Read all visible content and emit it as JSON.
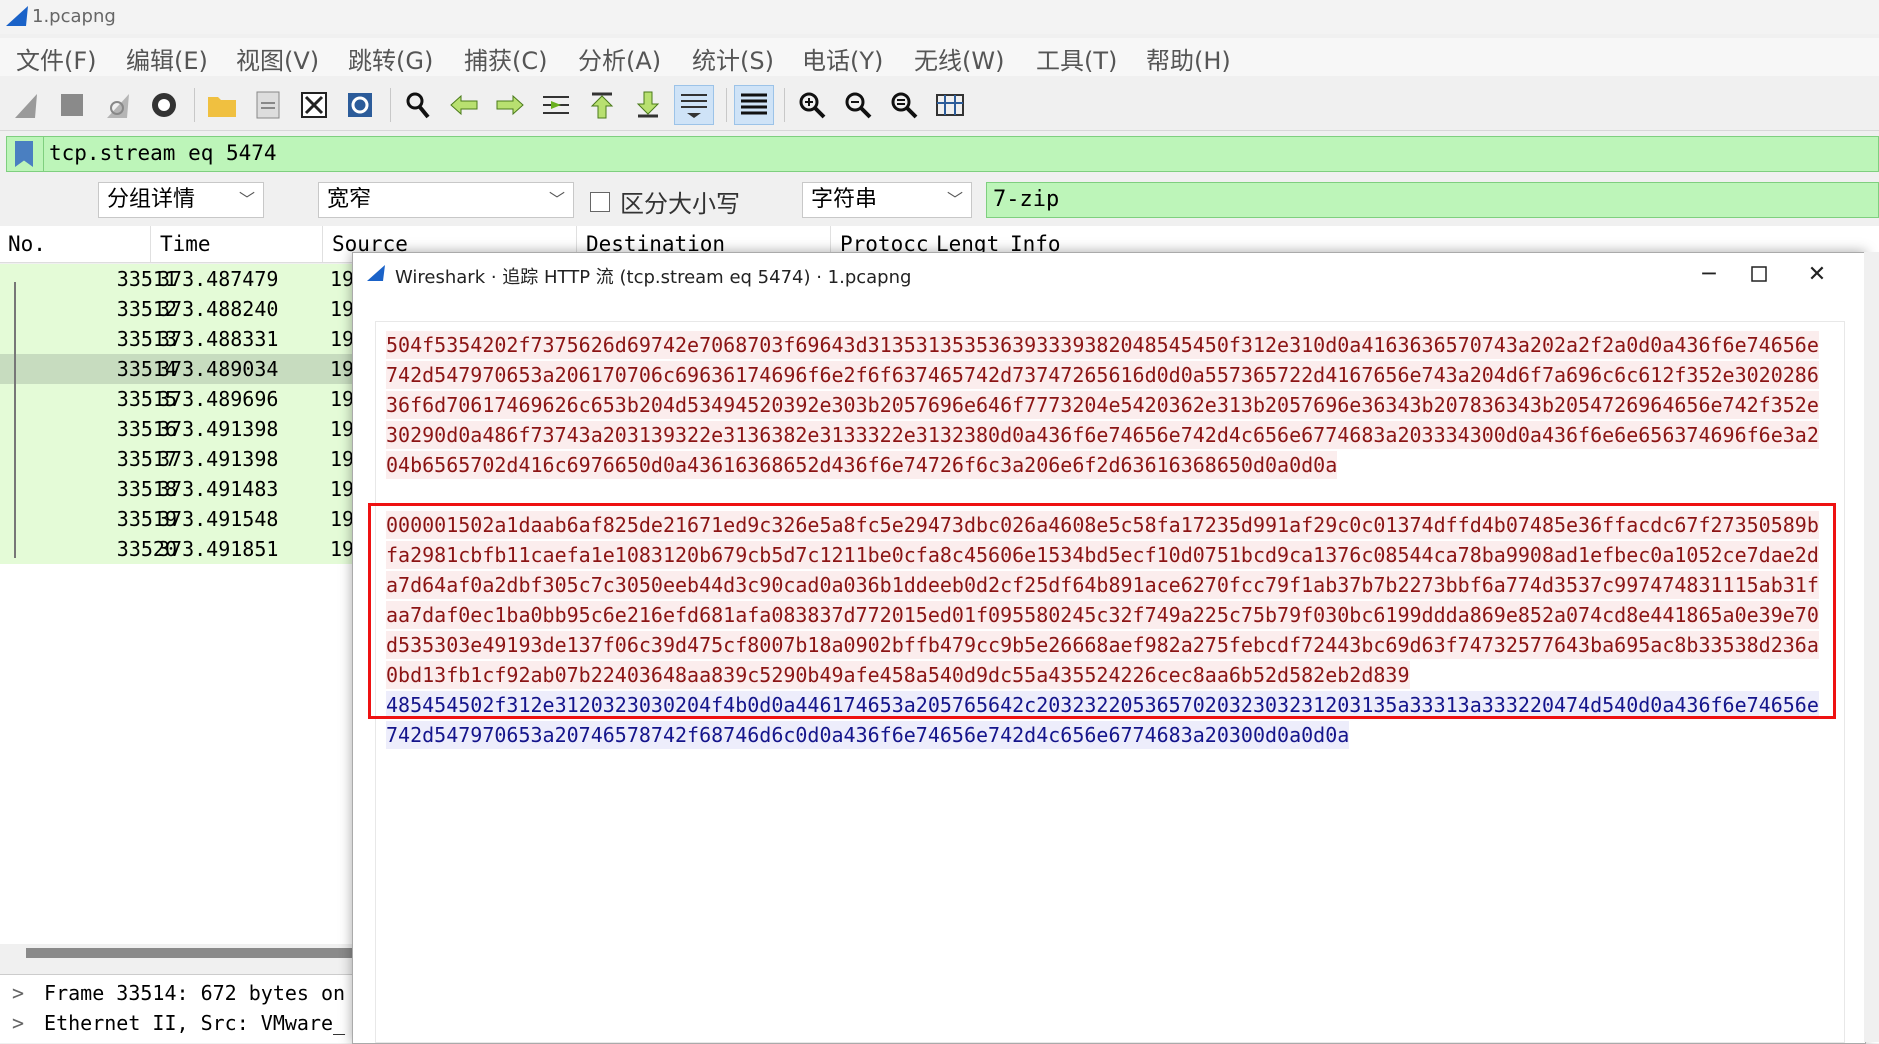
{
  "window": {
    "title": "1.pcapng"
  },
  "menu": [
    "文件(F)",
    "编辑(E)",
    "视图(V)",
    "跳转(G)",
    "捕获(C)",
    "分析(A)",
    "统计(S)",
    "电话(Y)",
    "无线(W)",
    "工具(T)",
    "帮助(H)"
  ],
  "filter": {
    "value": "tcp.stream eq 5474"
  },
  "search": {
    "scope": "分组详情",
    "width_mode": "宽窄",
    "case_sensitive_label": "区分大小写",
    "type": "字符串",
    "value": "7-zip"
  },
  "packet_list": {
    "columns": [
      "No.",
      "Time",
      "Source",
      "Destination",
      "Protocc",
      "Lengt",
      "Info"
    ],
    "rows": [
      {
        "no": "33511",
        "time": "373.487479",
        "src": "19"
      },
      {
        "no": "33512",
        "time": "373.488240",
        "src": "19"
      },
      {
        "no": "33513",
        "time": "373.488331",
        "src": "19"
      },
      {
        "no": "33514",
        "time": "373.489034",
        "src": "19"
      },
      {
        "no": "33515",
        "time": "373.489696",
        "src": "19"
      },
      {
        "no": "33516",
        "time": "373.491398",
        "src": "19"
      },
      {
        "no": "33517",
        "time": "373.491398",
        "src": "19"
      },
      {
        "no": "33518",
        "time": "373.491483",
        "src": "19"
      },
      {
        "no": "33519",
        "time": "373.491548",
        "src": "19"
      },
      {
        "no": "33520",
        "time": "373.491851",
        "src": "19"
      }
    ]
  },
  "details": [
    "Frame 33514: 672 bytes on",
    "Ethernet II, Src: VMware_"
  ],
  "dialog": {
    "title": "Wireshark · 追踪 HTTP 流 (tcp.stream eq 5474) · 1.pcapng",
    "client_request": "504f5354202f7375626d69742e7068703f69643d313531353536393339382048545450f312e310d0a4163636570743a202a2f2a0d0a436f6e74656e742d547970653a206170706c69636174696f6e2f6f637465742d73747265616d0d0a557365722d4167656e743a204d6f7a696c6c612f352e302028636f6d70617469626c653b204d53494520392e303b2057696e646f7773204e5420362e313b2057696e36343b207836343b2054726964656e742f352e30290d0a486f73743a203139322e3136382e3133322e3132380d0a436f6e74656e742d4c656e6774683a203334300d0a436f6e6e656374696f6e3a204b6565702d416c6976650d0a43616368652d436f6e74726f6c3a206e6f2d63616368650d0a0d0a",
    "client_body": "000001502a1daab6af825de21671ed9c326e5a8fc5e29473dbc026a4608e5c58fa17235d991af29c0c01374dffd4b07485e36ffacdc67f27350589bfa2981cbfb11caefa1e1083120b679cb5d7c1211be0cfa8c45606e1534bd5ecf10d0751bcd9ca1376c08544ca78ba9908ad1efbec0a1052ce7dae2da7d64af0a2dbf305c7c3050eeb44d3c90cad0a036b1ddeeb0d2cf25df64b891ace6270fcc79f1ab37b7b2273bbf6a774d3537c997474831115ab31faa7daf0ec1ba0bb95c6e216efd681afa083837d772015ed01f095580245c32f749a225c75b79f030bc6199ddda869e852a074cd8e441865a0e39e70d535303e49193de137f06c39d475cf8007b18a0902bffb479cc9b5e26668aef982a275febcdf72443bc69d63f74732577643ba695ac8b33538d236a0bd13fb1cf92ab07b22403648aa839c5290b49afe458a540d9dc55a435524226cec8aa6b52d582eb2d839",
    "server_response": "485454502f312e3120323030204f4b0d0a446174653a205765642c203232205365702032303231203135a33313a333220474d540d0a436f6e74656e742d547970653a20746578742f68746d6c0d0a436f6e74656e742d4c656e6774683a20300d0a0d0a"
  },
  "colors": {
    "filter_ok": "#bdf5b9",
    "row_bg": "#e4fbd7",
    "client_text": "#8b1414",
    "server_text": "#14148b",
    "highlight": "#ee1111"
  }
}
